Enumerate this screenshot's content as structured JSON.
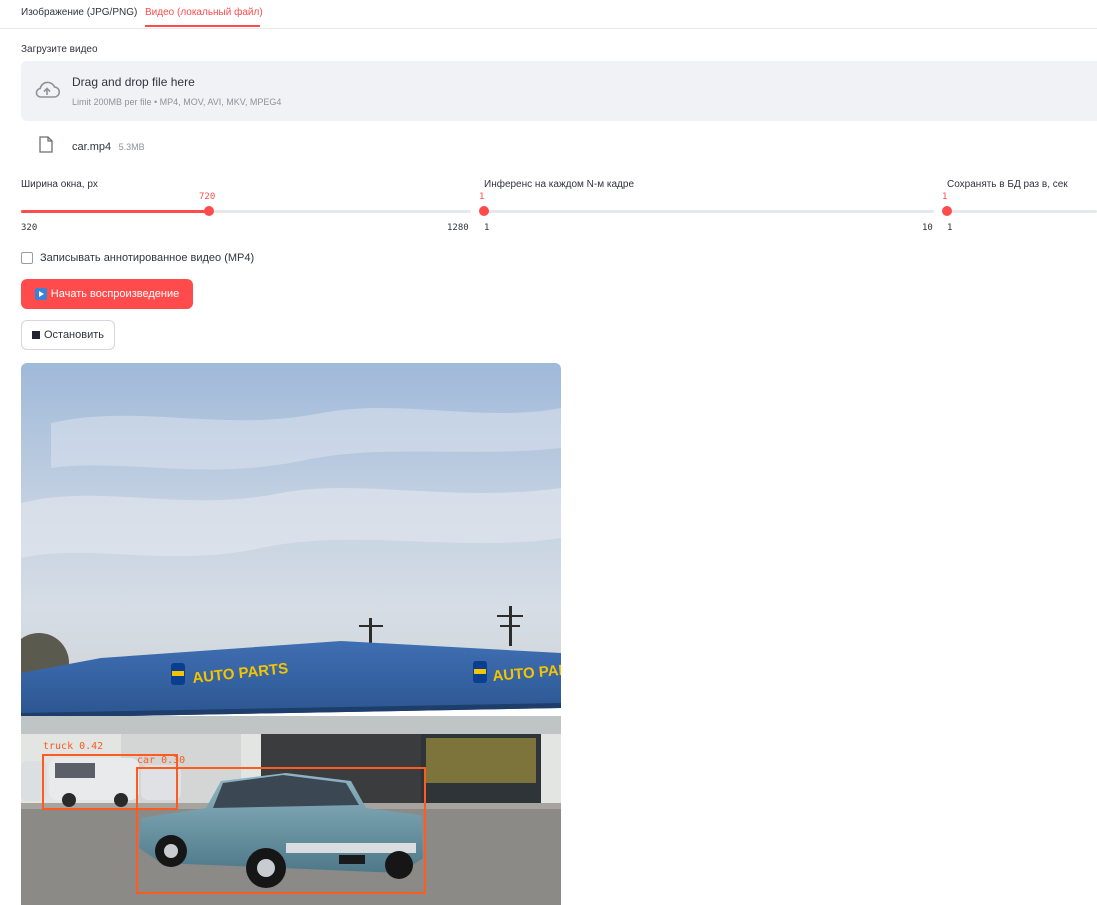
{
  "tabs": [
    {
      "label": "Изображение (JPG/PNG)",
      "active": false
    },
    {
      "label": "Видео (локальный файл)",
      "active": true
    }
  ],
  "uploader": {
    "label": "Загрузите видео",
    "drop_title": "Drag and drop file here",
    "drop_subtitle": "Limit 200MB per file • MP4, MOV, AVI, MKV, MPEG4",
    "icon": "cloud-upload-icon"
  },
  "file": {
    "name": "car.mp4",
    "size": "5.3MB",
    "icon": "file-icon"
  },
  "sliders": [
    {
      "label": "Ширина окна, px",
      "value": "720",
      "min": "320",
      "max": "1280",
      "fraction": 0.4167
    },
    {
      "label": "Инференс на каждом N-м кадре",
      "value": "1",
      "min": "1",
      "max": "10",
      "fraction": 0
    },
    {
      "label": "Сохранять в БД раз в, сек",
      "value": "1",
      "min": "1",
      "max": "",
      "fraction": 0
    }
  ],
  "checkbox": {
    "label": "Записывать аннотированное видео (MP4)",
    "checked": false
  },
  "buttons": {
    "start": "Начать воспроизведение",
    "stop": "Остановить"
  },
  "detections": [
    {
      "label": "truck 0.42"
    },
    {
      "label": "car 0.30"
    }
  ],
  "colors": {
    "accent": "#ff4b4b",
    "detection_box": "#ff5a1f",
    "dropzone_bg": "#f0f2f6"
  }
}
